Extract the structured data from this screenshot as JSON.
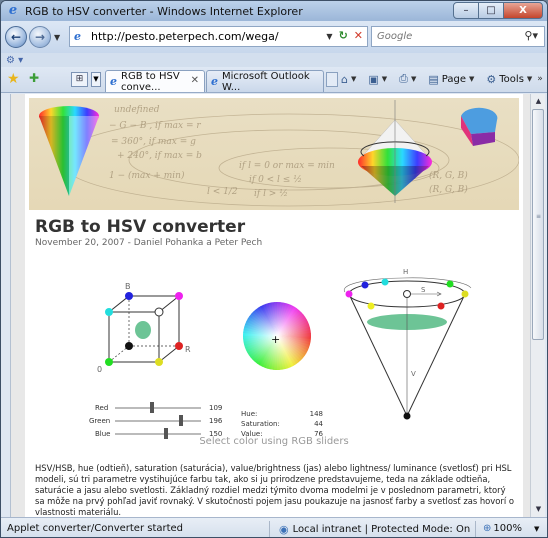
{
  "window": {
    "title": "RGB to HSV converter - Windows Internet Explorer",
    "minimize": "–",
    "maximize": "□",
    "close": "X"
  },
  "navbar": {
    "back": "←",
    "forward": "→",
    "url": "http://pesto.peterpech.com/wega/",
    "search_placeholder": "Google"
  },
  "tabs": [
    {
      "label": "RGB to HSV conve...",
      "active": true
    },
    {
      "label": "Microsoft Outlook W...",
      "active": false
    }
  ],
  "command_bar": {
    "page": "Page",
    "tools": "Tools"
  },
  "page": {
    "title": "RGB to HSV converter",
    "subtitle": "November 20, 2007 - Daniel Pohanka a Peter Pech",
    "cube_labels": {
      "b": "B",
      "r": "R",
      "o": "0"
    },
    "cone_labels": {
      "h": "H",
      "s": "S",
      "v": "V"
    },
    "sliders": [
      {
        "label": "Red",
        "value": "109",
        "level": 0.43
      },
      {
        "label": "Green",
        "value": "196",
        "level": 0.77
      },
      {
        "label": "Blue",
        "value": "150",
        "level": 0.59
      }
    ],
    "hsv": [
      {
        "label": "Hue:",
        "value": "148"
      },
      {
        "label": "Saturation:",
        "value": "44"
      },
      {
        "label": "Value:",
        "value": "76"
      }
    ],
    "caption": "Select color using RGB sliders",
    "paragraph": "HSV/HSB, hue (odtieň), saturation (saturácia), value/brightness (jas) alebo lightness/ luminance (svetlosť) pri HSL modeli, sú tri parametre vystihujúce farbu tak, ako si ju prirodzene predstavujeme, teda na základe odtieňa, saturácie a jasu alebo svetlosti. Základný rozdiel medzi týmito dvoma modelmi je v poslednom parametri, ktorý sa môže na prvý pohľad javiť rovnaký. V skutočnosti pojem jasu poukazuje na jasnosť farby a svetlosť zas hovorí o vlastnosti materiálu."
  },
  "status": {
    "text": "Applet converter/Converter started",
    "zone": "Local intranet | Protected Mode: On",
    "zoom": "100%"
  },
  "colors": {
    "accent_green": "#6dc496",
    "ie_blue": "#2e6fd0"
  }
}
